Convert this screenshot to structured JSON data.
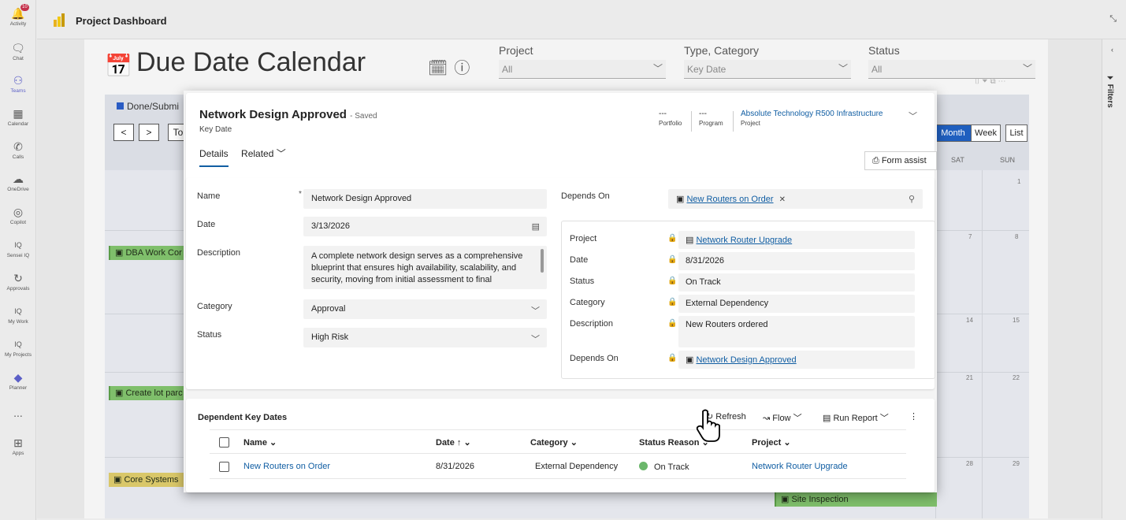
{
  "rail": {
    "items": [
      {
        "label": "Activity",
        "icon": "bell-icon",
        "badge": "10"
      },
      {
        "label": "Chat",
        "icon": "chat-icon"
      },
      {
        "label": "Teams",
        "icon": "teams-icon"
      },
      {
        "label": "Calendar",
        "icon": "calendar-icon"
      },
      {
        "label": "Calls",
        "icon": "phone-icon"
      },
      {
        "label": "OneDrive",
        "icon": "cloud-icon"
      },
      {
        "label": "Copilot",
        "icon": "copilot-icon"
      },
      {
        "label": "Sensei IQ",
        "icon": "iq-icon"
      },
      {
        "label": "Approvals",
        "icon": "approvals-icon"
      },
      {
        "label": "My Work",
        "icon": "iq-icon"
      },
      {
        "label": "My Projects",
        "icon": "iq-icon"
      },
      {
        "label": "Planner",
        "icon": "planner-icon"
      },
      {
        "label": "...",
        "icon": "more-icon"
      },
      {
        "label": "Apps",
        "icon": "apps-icon"
      }
    ]
  },
  "topbar": {
    "title": "Project Dashboard"
  },
  "report": {
    "title": "Due Date Calendar",
    "slicers": [
      {
        "label": "Project",
        "value": "All"
      },
      {
        "label": "Type, Category",
        "value": "Key Date"
      },
      {
        "label": "Status",
        "value": "All"
      }
    ],
    "legend": "Done/Submi",
    "nav": {
      "prev": "<",
      "next": ">",
      "today": "To"
    },
    "views": [
      "Month",
      "Week",
      "List"
    ],
    "daynames": [
      "SAT",
      "SUN"
    ],
    "daynums": [
      "1",
      "7",
      "8",
      "14",
      "15",
      "21",
      "22",
      "28",
      "29"
    ],
    "events": [
      "DBA Work Cor",
      "Create lot parc",
      "Core Systems",
      "Site Inspection"
    ]
  },
  "modal": {
    "title": "Network Design Approved",
    "saved": "- Saved",
    "entity": "Key Date",
    "header_fields": [
      {
        "value": "---",
        "label": "Portfolio"
      },
      {
        "value": "---",
        "label": "Program"
      },
      {
        "value": "Absolute Technology R500 Infrastructure",
        "label": "Project"
      }
    ],
    "tabs": [
      "Details",
      "Related"
    ],
    "form_assist": "Form assist",
    "fields": {
      "name": {
        "label": "Name",
        "value": "Network Design Approved"
      },
      "date": {
        "label": "Date",
        "value": "3/13/2026"
      },
      "description": {
        "label": "Description",
        "value": "A complete network design serves as a comprehensive blueprint that ensures high availability, scalability, and security, moving from initial assessment to final"
      },
      "category": {
        "label": "Category",
        "value": "Approval"
      },
      "status": {
        "label": "Status",
        "value": "High Risk"
      },
      "depends_on": {
        "label": "Depends On",
        "value": "New Routers on Order"
      }
    },
    "quick_view": [
      {
        "label": "Project",
        "value": "Network Router Upgrade",
        "link": true
      },
      {
        "label": "Date",
        "value": "8/31/2026"
      },
      {
        "label": "Status",
        "value": "On Track"
      },
      {
        "label": "Category",
        "value": "External Dependency"
      },
      {
        "label": "Description",
        "value": "New Routers ordered"
      },
      {
        "label": "Depends On",
        "value": "Network Design Approved",
        "link": true
      }
    ],
    "subgrid": {
      "title": "Dependent Key Dates",
      "commands": [
        "Refresh",
        "Flow",
        "Run Report"
      ],
      "columns": [
        "Name",
        "Date",
        "Category",
        "Status Reason",
        "Project"
      ],
      "rows": [
        {
          "name": "New Routers on Order",
          "date": "8/31/2026",
          "category": "External Dependency",
          "status": "On Track",
          "project": "Network Router Upgrade"
        }
      ]
    }
  },
  "filters": {
    "label": "Filters"
  },
  "colors": {
    "accent": "#115ea3",
    "teams": "#5b5fc7",
    "on_track": "#6bb76b",
    "event_green": "#7fbf6b",
    "event_yellow": "#d9c769"
  }
}
